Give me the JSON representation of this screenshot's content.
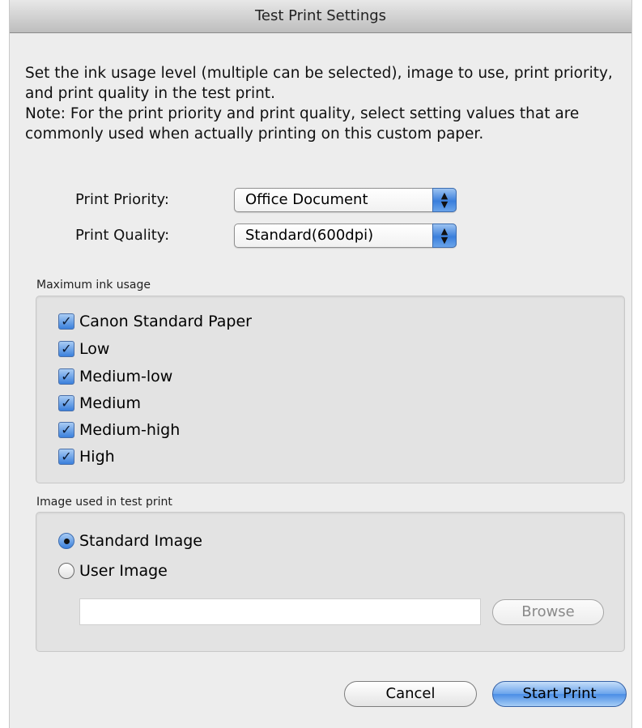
{
  "dialog": {
    "title": "Test Print Settings"
  },
  "intro": {
    "line1": "Set the ink usage level (multiple can be selected), image to use, print priority, and print quality in the test print.",
    "line2": "Note: For the print priority and print quality, select setting values that are commonly used when actually printing on this custom paper."
  },
  "print_priority": {
    "label": "Print Priority:",
    "value": "Office Document"
  },
  "print_quality": {
    "label": "Print Quality:",
    "value": "Standard(600dpi)"
  },
  "ink_usage": {
    "label": "Maximum ink usage",
    "options": [
      {
        "label": "Canon Standard Paper",
        "checked": true
      },
      {
        "label": "Low",
        "checked": true
      },
      {
        "label": "Medium-low",
        "checked": true
      },
      {
        "label": "Medium",
        "checked": true
      },
      {
        "label": "Medium-high",
        "checked": true
      },
      {
        "label": "High",
        "checked": true
      }
    ]
  },
  "image": {
    "label": "Image used in test print",
    "options": [
      {
        "label": "Standard Image",
        "selected": true
      },
      {
        "label": "User Image",
        "selected": false
      }
    ],
    "path_value": "",
    "browse_label": "Browse"
  },
  "buttons": {
    "cancel": "Cancel",
    "start": "Start Print"
  },
  "icons": {
    "checkmark": "check-icon",
    "popup": "up-down-arrows-icon",
    "radio": "radio-dot-icon"
  }
}
